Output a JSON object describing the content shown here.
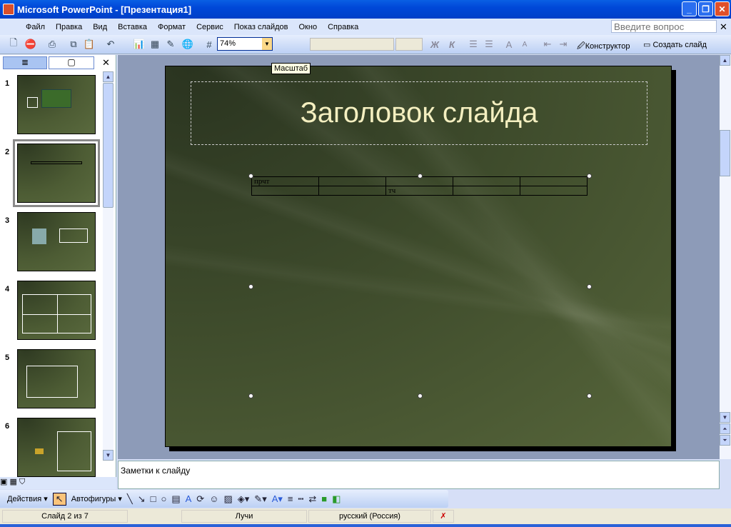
{
  "window": {
    "title": "Microsoft PowerPoint - [Презентация1]"
  },
  "menu": [
    "Файл",
    "Правка",
    "Вид",
    "Вставка",
    "Формат",
    "Сервис",
    "Показ слайдов",
    "Окно",
    "Справка"
  ],
  "help": {
    "placeholder": "Введите вопрос"
  },
  "toolbar": {
    "zoom": "74%",
    "zoom_tooltip": "Масштаб",
    "bold": "Ж",
    "italic": "К",
    "designer": "Конструктор",
    "new_slide": "Создать слайд"
  },
  "slides_pane": {
    "thumbnails": [
      "1",
      "2",
      "3",
      "4",
      "5",
      "6"
    ],
    "selected": 2
  },
  "slide": {
    "title": "Заголовок слайда",
    "table": [
      [
        "прчт",
        "",
        "",
        "",
        ""
      ],
      [
        "",
        "",
        "тч",
        "",
        ""
      ]
    ]
  },
  "notes": {
    "placeholder": "Заметки к слайду"
  },
  "drawing": {
    "actions": "Действия",
    "autoshapes": "Автофигуры"
  },
  "status": {
    "slide": "Слайд 2 из 7",
    "design": "Лучи",
    "language": "русский (Россия)"
  }
}
